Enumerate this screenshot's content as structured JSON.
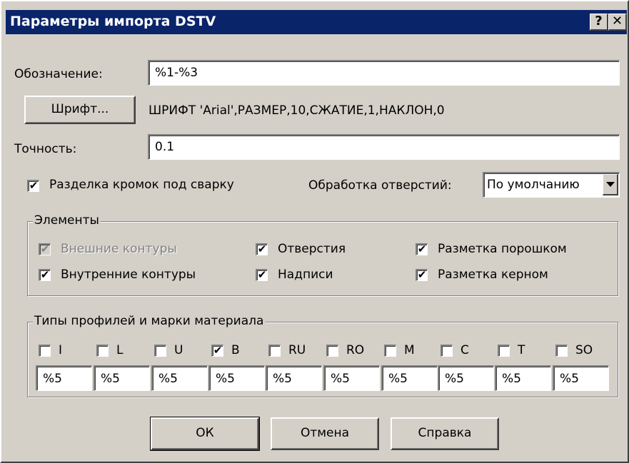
{
  "window": {
    "title": "Параметры импорта DSTV",
    "help_button": "?",
    "close_button": "✕"
  },
  "designation": {
    "label": "Обозначение:",
    "value": "%1-%3"
  },
  "font": {
    "button_label": "Шрифт...",
    "description": "ШРИФТ 'Arial',РАЗМЕР,10,СЖАТИЕ,1,НАКЛОН,0"
  },
  "precision": {
    "label": "Точность:",
    "value": "0.1"
  },
  "weld_edge": {
    "label": "Разделка кромок под сварку",
    "checked": true
  },
  "hole_processing": {
    "label": "Обработка отверстий:",
    "selected": "По умолчанию"
  },
  "elements": {
    "legend": "Элементы",
    "items": [
      {
        "label": "Внешние контуры",
        "checked": true,
        "disabled": true
      },
      {
        "label": "Отверстия",
        "checked": true,
        "disabled": false
      },
      {
        "label": "Разметка порошком",
        "checked": true,
        "disabled": false
      },
      {
        "label": "Внутренние контуры",
        "checked": true,
        "disabled": false
      },
      {
        "label": "Надписи",
        "checked": true,
        "disabled": false
      },
      {
        "label": "Разметка керном",
        "checked": true,
        "disabled": false
      }
    ]
  },
  "profiles": {
    "legend": "Типы профилей и марки материала",
    "items": [
      {
        "label": "I",
        "checked": false,
        "value": "%5"
      },
      {
        "label": "L",
        "checked": false,
        "value": "%5"
      },
      {
        "label": "U",
        "checked": false,
        "value": "%5"
      },
      {
        "label": "B",
        "checked": true,
        "value": "%5"
      },
      {
        "label": "RU",
        "checked": false,
        "value": "%5"
      },
      {
        "label": "RO",
        "checked": false,
        "value": "%5"
      },
      {
        "label": "M",
        "checked": false,
        "value": "%5"
      },
      {
        "label": "C",
        "checked": false,
        "value": "%5"
      },
      {
        "label": "T",
        "checked": false,
        "value": "%5"
      },
      {
        "label": "SO",
        "checked": false,
        "value": "%5"
      }
    ]
  },
  "buttons": {
    "ok": "ОК",
    "cancel": "Отмена",
    "help": "Справка"
  },
  "check_glyph": "✔"
}
